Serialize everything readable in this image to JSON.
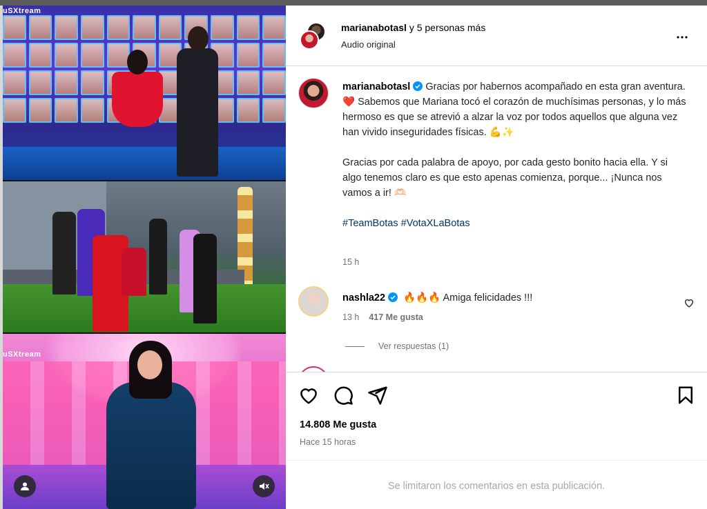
{
  "media": {
    "watermark_top": "uSXtream",
    "watermark_bottom": "uSXtream"
  },
  "header": {
    "username": "marianabotasl",
    "others": " y 5 personas más",
    "subtitle": "Audio original"
  },
  "caption": {
    "username": "marianabotasl",
    "paragraph_1": "Gracias por habernos acompañado en esta gran aventura. ❤️ Sabemos que Mariana tocó el corazón de muchísimas personas, y lo más hermoso es que se atrevió a alzar la voz por todos aquellos que alguna vez han vivido inseguridades físicas. 💪✨",
    "paragraph_2": "Gracias por cada palabra de apoyo, por cada gesto bonito hacia ella. Y si algo tenemos claro es que esto apenas comienza, porque... ¡Nunca nos vamos a ir! 🫶🏻",
    "hashtags": "#TeamBotas #VotaXLaBotas",
    "time": "15 h"
  },
  "comment": {
    "username": "nashla22",
    "text": " 🔥🔥🔥 Amiga felicidades !!!",
    "time": "13 h",
    "likes": "417 Me gusta",
    "replies": "Ver respuestas (1)"
  },
  "post": {
    "likes": "14.808 Me gusta",
    "time": "Hace 15 horas",
    "limited_comments": "Se limitaron los comentarios en esta publicación."
  },
  "colors": {
    "verified": "#0095f6",
    "link": "#00376b",
    "muted": "#737373"
  },
  "icons": [
    "more-options-icon",
    "verified-icon",
    "heart-icon",
    "comment-icon",
    "share-icon",
    "save-icon",
    "user-tag-icon",
    "mute-icon"
  ]
}
